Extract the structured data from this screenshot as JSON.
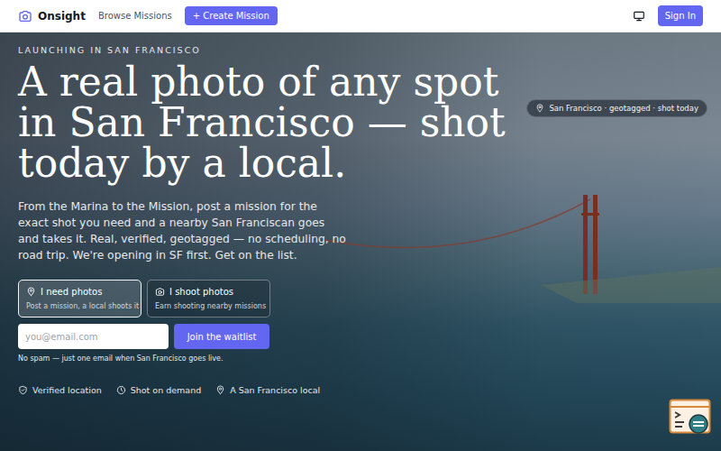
{
  "nav": {
    "brand": "Onsight",
    "links": [
      "Browse Missions"
    ],
    "create_button": "+ Create Mission",
    "sign_in": "Sign In"
  },
  "hero": {
    "eyebrow": "LAUNCHING IN SAN FRANCISCO",
    "headline": [
      "A real photo of any spot",
      "in San Francisco — shot",
      "today by a local."
    ],
    "description": "From the Marina to the Mission, post a mission for the exact shot you need and a nearby San Franciscan goes and takes it. Real, verified, geotagged — no scheduling, no road trip. We're opening in SF first. Get on the list.",
    "badge": "San Francisco · geotagged · shot today",
    "roles": [
      {
        "title": "I need photos",
        "subtitle": "Post a mission, a local shoots it",
        "selected": true
      },
      {
        "title": "I shoot photos",
        "subtitle": "Earn shooting nearby missions",
        "selected": false
      }
    ],
    "email": {
      "placeholder": "you@email.com"
    },
    "submit": "Join the waitlist",
    "note": "No spam — just one email when San Francisco goes live.",
    "features": [
      "Verified location",
      "Shot on demand",
      "A San Francisco local"
    ]
  }
}
